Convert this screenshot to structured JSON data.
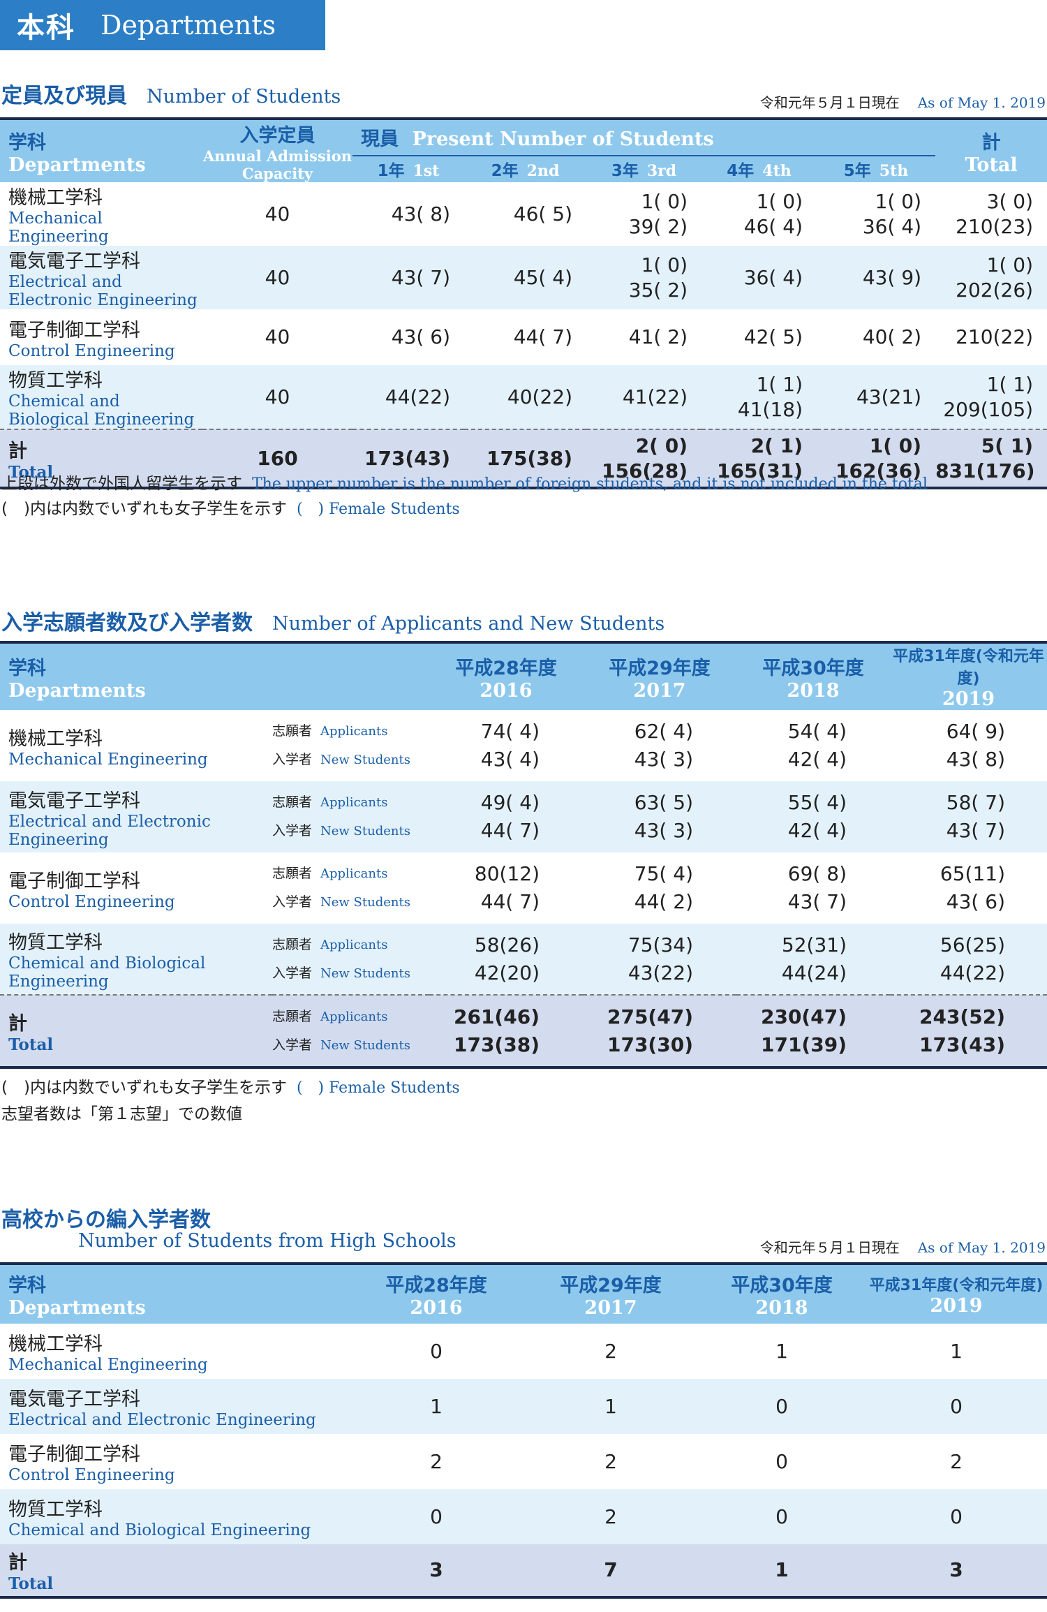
{
  "banner": {
    "jp": "本科",
    "en": "Departments"
  },
  "s1": {
    "title_jp": "定員及び現員",
    "title_en": "Number of Students",
    "asof_jp": "令和元年５月１日現在",
    "asof_en": "As of May 1. 2019",
    "h_dept_jp": "学科",
    "h_dept_en": "Departments",
    "h_cap_jp": "入学定員",
    "h_cap_en": "Annual Admission Capacity",
    "h_present_jp": "現員",
    "h_present_en": "Present Number of Students",
    "h_total_jp": "計",
    "h_total_en": "Total",
    "years": [
      {
        "jp": "1年",
        "en": "1st"
      },
      {
        "jp": "2年",
        "en": "2nd"
      },
      {
        "jp": "3年",
        "en": "3rd"
      },
      {
        "jp": "4年",
        "en": "4th"
      },
      {
        "jp": "5年",
        "en": "5th"
      }
    ],
    "rows": [
      {
        "jp": "機械工学科",
        "en": "Mechanical Engineering",
        "cap": "40",
        "y1": [
          "",
          "43( 8)"
        ],
        "y2": [
          "",
          "46( 5)"
        ],
        "y3": [
          "1( 0)",
          "39( 2)"
        ],
        "y4": [
          "1( 0)",
          "46( 4)"
        ],
        "y5": [
          "1( 0)",
          "36( 4)"
        ],
        "total": [
          "3( 0)",
          "210(23)"
        ]
      },
      {
        "jp": "電気電子工学科",
        "en": "Electrical and Electronic Engineering",
        "cap": "40",
        "y1": [
          "",
          "43( 7)"
        ],
        "y2": [
          "",
          "45( 4)"
        ],
        "y3": [
          "1( 0)",
          "35( 2)"
        ],
        "y4": [
          "",
          "36( 4)"
        ],
        "y5": [
          "",
          "43( 9)"
        ],
        "total": [
          "1( 0)",
          "202(26)"
        ]
      },
      {
        "jp": "電子制御工学科",
        "en": "Control Engineering",
        "cap": "40",
        "y1": [
          "",
          "43( 6)"
        ],
        "y2": [
          "",
          "44( 7)"
        ],
        "y3": [
          "",
          "41( 2)"
        ],
        "y4": [
          "",
          "42( 5)"
        ],
        "y5": [
          "",
          "40( 2)"
        ],
        "total": [
          "",
          "210(22)"
        ]
      },
      {
        "jp": "物質工学科",
        "en": "Chemical and Biological Engineering",
        "cap": "40",
        "y1": [
          "",
          "44(22)"
        ],
        "y2": [
          "",
          "40(22)"
        ],
        "y3": [
          "",
          "41(22)"
        ],
        "y4": [
          "1( 1)",
          "41(18)"
        ],
        "y5": [
          "",
          "43(21)"
        ],
        "total": [
          "1( 1)",
          "209(105)"
        ]
      }
    ],
    "total": {
      "jp": "計",
      "en": "Total",
      "cap": "160",
      "y1": [
        "",
        "173(43)"
      ],
      "y2": [
        "",
        "175(38)"
      ],
      "y3": [
        "2( 0)",
        "156(28)"
      ],
      "y4": [
        "2( 1)",
        "165(31)"
      ],
      "y5": [
        "1( 0)",
        "162(36)"
      ],
      "total": [
        "5( 1)",
        "831(176)"
      ]
    },
    "note1_jp": "上段は外数で外国人留学生を示す",
    "note1_en": "The upper number is the number of foreign students, and it is not included in the total",
    "note2_jp": "(　)内は内数でいずれも女子学生を示す",
    "note2_en": "(　) Female Students"
  },
  "s2": {
    "title_jp": "入学志願者数及び入学者数",
    "title_en": "Number of Applicants and New Students",
    "h_dept_jp": "学科",
    "h_dept_en": "Departments",
    "years": [
      {
        "jp": "平成28年度",
        "en": "2016"
      },
      {
        "jp": "平成29年度",
        "en": "2017"
      },
      {
        "jp": "平成30年度",
        "en": "2018"
      },
      {
        "jp": "平成31年度(令和元年度)",
        "en": "2019"
      }
    ],
    "lab_app_jp": "志願者",
    "lab_app_en": "Applicants",
    "lab_new_jp": "入学者",
    "lab_new_en": "New Students",
    "rows": [
      {
        "jp": "機械工学科",
        "en": "Mechanical Engineering",
        "app": [
          "74( 4)",
          "62( 4)",
          "54( 4)",
          "64( 9)"
        ],
        "new": [
          "43( 4)",
          "43( 3)",
          "42( 4)",
          "43( 8)"
        ]
      },
      {
        "jp": "電気電子工学科",
        "en": "Electrical and Electronic Engineering",
        "app": [
          "49( 4)",
          "63( 5)",
          "55( 4)",
          "58( 7)"
        ],
        "new": [
          "44( 7)",
          "43( 3)",
          "42( 4)",
          "43( 7)"
        ]
      },
      {
        "jp": "電子制御工学科",
        "en": "Control Engineering",
        "app": [
          "80(12)",
          "75( 4)",
          "69( 8)",
          "65(11)"
        ],
        "new": [
          "44( 7)",
          "44( 2)",
          "43( 7)",
          "43( 6)"
        ]
      },
      {
        "jp": "物質工学科",
        "en": "Chemical and Biological Engineering",
        "app": [
          "58(26)",
          "75(34)",
          "52(31)",
          "56(25)"
        ],
        "new": [
          "42(20)",
          "43(22)",
          "44(24)",
          "44(22)"
        ]
      }
    ],
    "total": {
      "jp": "計",
      "en": "Total",
      "app": [
        "261(46)",
        "275(47)",
        "230(47)",
        "243(52)"
      ],
      "new": [
        "173(38)",
        "173(30)",
        "171(39)",
        "173(43)"
      ]
    },
    "note1_jp": "(　)内は内数でいずれも女子学生を示す",
    "note1_en": "(　) Female Students",
    "note2_jp": "志望者数は「第１志望」での数値"
  },
  "s3": {
    "title_jp": "高校からの編入学者数",
    "title_en": "Number of Students from High Schools",
    "asof_jp": "令和元年５月１日現在",
    "asof_en": "As of May 1. 2019",
    "h_dept_jp": "学科",
    "h_dept_en": "Departments",
    "years": [
      {
        "jp": "平成28年度",
        "en": "2016"
      },
      {
        "jp": "平成29年度",
        "en": "2017"
      },
      {
        "jp": "平成30年度",
        "en": "2018"
      },
      {
        "jp": "平成31年度(令和元年度)",
        "en": "2019"
      }
    ],
    "rows": [
      {
        "jp": "機械工学科",
        "en": "Mechanical Engineering",
        "v": [
          "0",
          "2",
          "1",
          "1"
        ]
      },
      {
        "jp": "電気電子工学科",
        "en": "Electrical and Electronic Engineering",
        "v": [
          "1",
          "1",
          "0",
          "0"
        ]
      },
      {
        "jp": "電子制御工学科",
        "en": "Control Engineering",
        "v": [
          "2",
          "2",
          "0",
          "2"
        ]
      },
      {
        "jp": "物質工学科",
        "en": "Chemical and Biological Engineering",
        "v": [
          "0",
          "2",
          "0",
          "0"
        ]
      }
    ],
    "total": {
      "jp": "計",
      "en": "Total",
      "v": [
        "3",
        "7",
        "1",
        "3"
      ]
    }
  }
}
